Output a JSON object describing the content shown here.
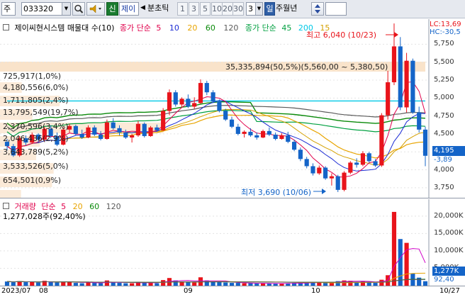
{
  "toolbar": {
    "market": "주",
    "code": "033320",
    "badge": "신",
    "name": "제이",
    "period_label": "분초틱",
    "periods": [
      "1",
      "3",
      "5",
      "10",
      "20",
      "30"
    ],
    "count": "3",
    "day_badge": "일",
    "dwm": "주월년"
  },
  "price_legend": {
    "title": "제이씨현시스템 매물대 수(10)",
    "ma_label": "종가 단순",
    "ma_values": [
      "5",
      "10",
      "20",
      "60",
      "120"
    ],
    "ma_colors": [
      "#e0004b",
      "#1c2cd4",
      "#e8a400",
      "#0a8a0a",
      "#5a5a5a"
    ],
    "ma2_label": "종가 단순",
    "ma2_values": [
      "45",
      "200",
      "15"
    ],
    "ma2_colors": [
      "#00a040",
      "#00c8e6",
      "#d4a000"
    ]
  },
  "volume_profile": [
    {
      "label": "35,335,894(50,5%)(5,560,00 ~ 5,380,50)",
      "share": 0.505
    },
    {
      "label": "725,917(1,0%)",
      "share": 0.01
    },
    {
      "label": "4,180,556(6,0%)",
      "share": 0.06
    },
    {
      "label": "1,711,805(2,4%)",
      "share": 0.024
    },
    {
      "label": "13,795,549(19,7%)",
      "share": 0.197
    },
    {
      "label": "2,370,596(3,4%)",
      "share": 0.034
    },
    {
      "label": "2,046,436(2,9%)",
      "share": 0.029
    },
    {
      "label": "3,643,789(5,2%)",
      "share": 0.052
    },
    {
      "label": "3,533,526(5,0%)",
      "share": 0.05
    },
    {
      "label": "654,501(0,9%)",
      "share": 0.009
    }
  ],
  "annotations": {
    "high": "최고 6,040 (10/23)",
    "low": "최저 3,690 (10/06)",
    "lc": "LC:13,69",
    "hc": "HC:-30,5"
  },
  "price_axis": {
    "ticks": [
      "5,750",
      "5,500",
      "5,250",
      "5,000",
      "4,750",
      "4,500",
      "4,250",
      "4,000",
      "3,750"
    ],
    "current_price": "4,195",
    "current_change": "-3,89"
  },
  "volume_legend": {
    "title": "거래량",
    "ma_label": "단순",
    "ma_values": [
      "5",
      "20",
      "60",
      "120"
    ],
    "current": "1,277,028주(92,40%)"
  },
  "volume_axis": {
    "ticks": [
      "20,000K",
      "15,000K",
      "10,000K",
      "5,000K"
    ],
    "current": "1,277K",
    "current_pct": "92,40"
  },
  "date_axis": {
    "labels": [
      "2023/07",
      "08",
      "09",
      "10",
      "10/27"
    ]
  },
  "colors": {
    "up": "#e8141b",
    "down": "#1464c8",
    "profile_band": "#f7d9b8"
  },
  "chart_data": {
    "type": "candlestick",
    "y_range": [
      3600,
      6100
    ],
    "volume_range": [
      0,
      22000000
    ],
    "candles": [
      [
        4390,
        4430,
        4270,
        4330,
        1200000
      ],
      [
        4330,
        4360,
        4180,
        4200,
        1000000
      ],
      [
        4200,
        4470,
        4180,
        4440,
        1300000
      ],
      [
        4440,
        4480,
        4340,
        4380,
        1000000
      ],
      [
        4380,
        4520,
        4360,
        4490,
        1100000
      ],
      [
        4490,
        4510,
        4380,
        4420,
        900000
      ],
      [
        4420,
        4600,
        4400,
        4570,
        1400000
      ],
      [
        4570,
        4620,
        4440,
        4470,
        1000000
      ],
      [
        4470,
        4520,
        4330,
        4350,
        900000
      ],
      [
        4350,
        4590,
        4340,
        4560,
        1200000
      ],
      [
        4560,
        4640,
        4520,
        4610,
        1100000
      ],
      [
        4610,
        4630,
        4480,
        4500,
        800000
      ],
      [
        4500,
        4560,
        4430,
        4450,
        700000
      ],
      [
        4450,
        4620,
        4440,
        4590,
        1000000
      ],
      [
        4590,
        4620,
        4470,
        4490,
        800000
      ],
      [
        4490,
        4540,
        4410,
        4430,
        700000
      ],
      [
        4430,
        4700,
        4420,
        4660,
        1500000
      ],
      [
        4660,
        4720,
        4560,
        4580,
        900000
      ],
      [
        4580,
        4620,
        4480,
        4520,
        800000
      ],
      [
        4520,
        4560,
        4430,
        4450,
        700000
      ],
      [
        4450,
        4500,
        4380,
        4480,
        700000
      ],
      [
        4480,
        4680,
        4460,
        4640,
        1100000
      ],
      [
        4640,
        4660,
        4450,
        4470,
        900000
      ],
      [
        4470,
        4610,
        4460,
        4590,
        800000
      ],
      [
        4590,
        4630,
        4530,
        4550,
        700000
      ],
      [
        4550,
        4860,
        4540,
        4820,
        1600000
      ],
      [
        4820,
        5120,
        4760,
        5080,
        2200000
      ],
      [
        5080,
        5110,
        4880,
        4910,
        1500000
      ],
      [
        4910,
        5010,
        4880,
        4990,
        1200000
      ],
      [
        4990,
        5050,
        4860,
        4880,
        1000000
      ],
      [
        4880,
        5010,
        4850,
        4930,
        900000
      ],
      [
        4930,
        5260,
        4920,
        5210,
        2400000
      ],
      [
        5210,
        5240,
        5040,
        5080,
        1500000
      ],
      [
        5080,
        5110,
        4930,
        4950,
        1100000
      ],
      [
        4950,
        4980,
        4800,
        4820,
        1000000
      ],
      [
        4820,
        4850,
        4680,
        4700,
        900000
      ],
      [
        4700,
        4740,
        4580,
        4600,
        800000
      ],
      [
        4600,
        4640,
        4480,
        4500,
        800000
      ],
      [
        4500,
        4550,
        4450,
        4530,
        700000
      ],
      [
        4530,
        4580,
        4460,
        4480,
        700000
      ],
      [
        4480,
        4520,
        4420,
        4450,
        600000
      ],
      [
        4450,
        4560,
        4440,
        4540,
        700000
      ],
      [
        4540,
        4590,
        4470,
        4490,
        600000
      ],
      [
        4490,
        4520,
        4410,
        4430,
        600000
      ],
      [
        4430,
        4510,
        4420,
        4480,
        600000
      ],
      [
        4480,
        4530,
        4370,
        4390,
        700000
      ],
      [
        4390,
        4420,
        4260,
        4280,
        800000
      ],
      [
        4280,
        4310,
        4120,
        4150,
        900000
      ],
      [
        4150,
        4180,
        4020,
        4050,
        900000
      ],
      [
        4050,
        4090,
        3920,
        3950,
        1000000
      ],
      [
        3950,
        4060,
        3930,
        4030,
        900000
      ],
      [
        4030,
        4050,
        3860,
        3880,
        1000000
      ],
      [
        3880,
        3950,
        3780,
        3910,
        1100000
      ],
      [
        3910,
        3930,
        3690,
        3720,
        1300000
      ],
      [
        3720,
        3980,
        3700,
        3960,
        1500000
      ],
      [
        3960,
        4120,
        3940,
        4100,
        1400000
      ],
      [
        4100,
        4160,
        4030,
        4070,
        1000000
      ],
      [
        4070,
        4260,
        4050,
        4230,
        1300000
      ],
      [
        4230,
        4250,
        4100,
        4120,
        900000
      ],
      [
        4120,
        4150,
        4040,
        4060,
        800000
      ],
      [
        4060,
        4790,
        4040,
        4760,
        1700000
      ],
      [
        4760,
        5380,
        4700,
        5220,
        3000000
      ],
      [
        5220,
        6040,
        5180,
        5720,
        21200000
      ],
      [
        5720,
        5850,
        4830,
        4870,
        13400000
      ],
      [
        4870,
        5630,
        4800,
        5520,
        12300000
      ],
      [
        5520,
        5550,
        4780,
        4800,
        3500000
      ],
      [
        4800,
        4880,
        4520,
        4560,
        2300000
      ],
      [
        4560,
        4600,
        4050,
        4195,
        1277028
      ]
    ]
  }
}
